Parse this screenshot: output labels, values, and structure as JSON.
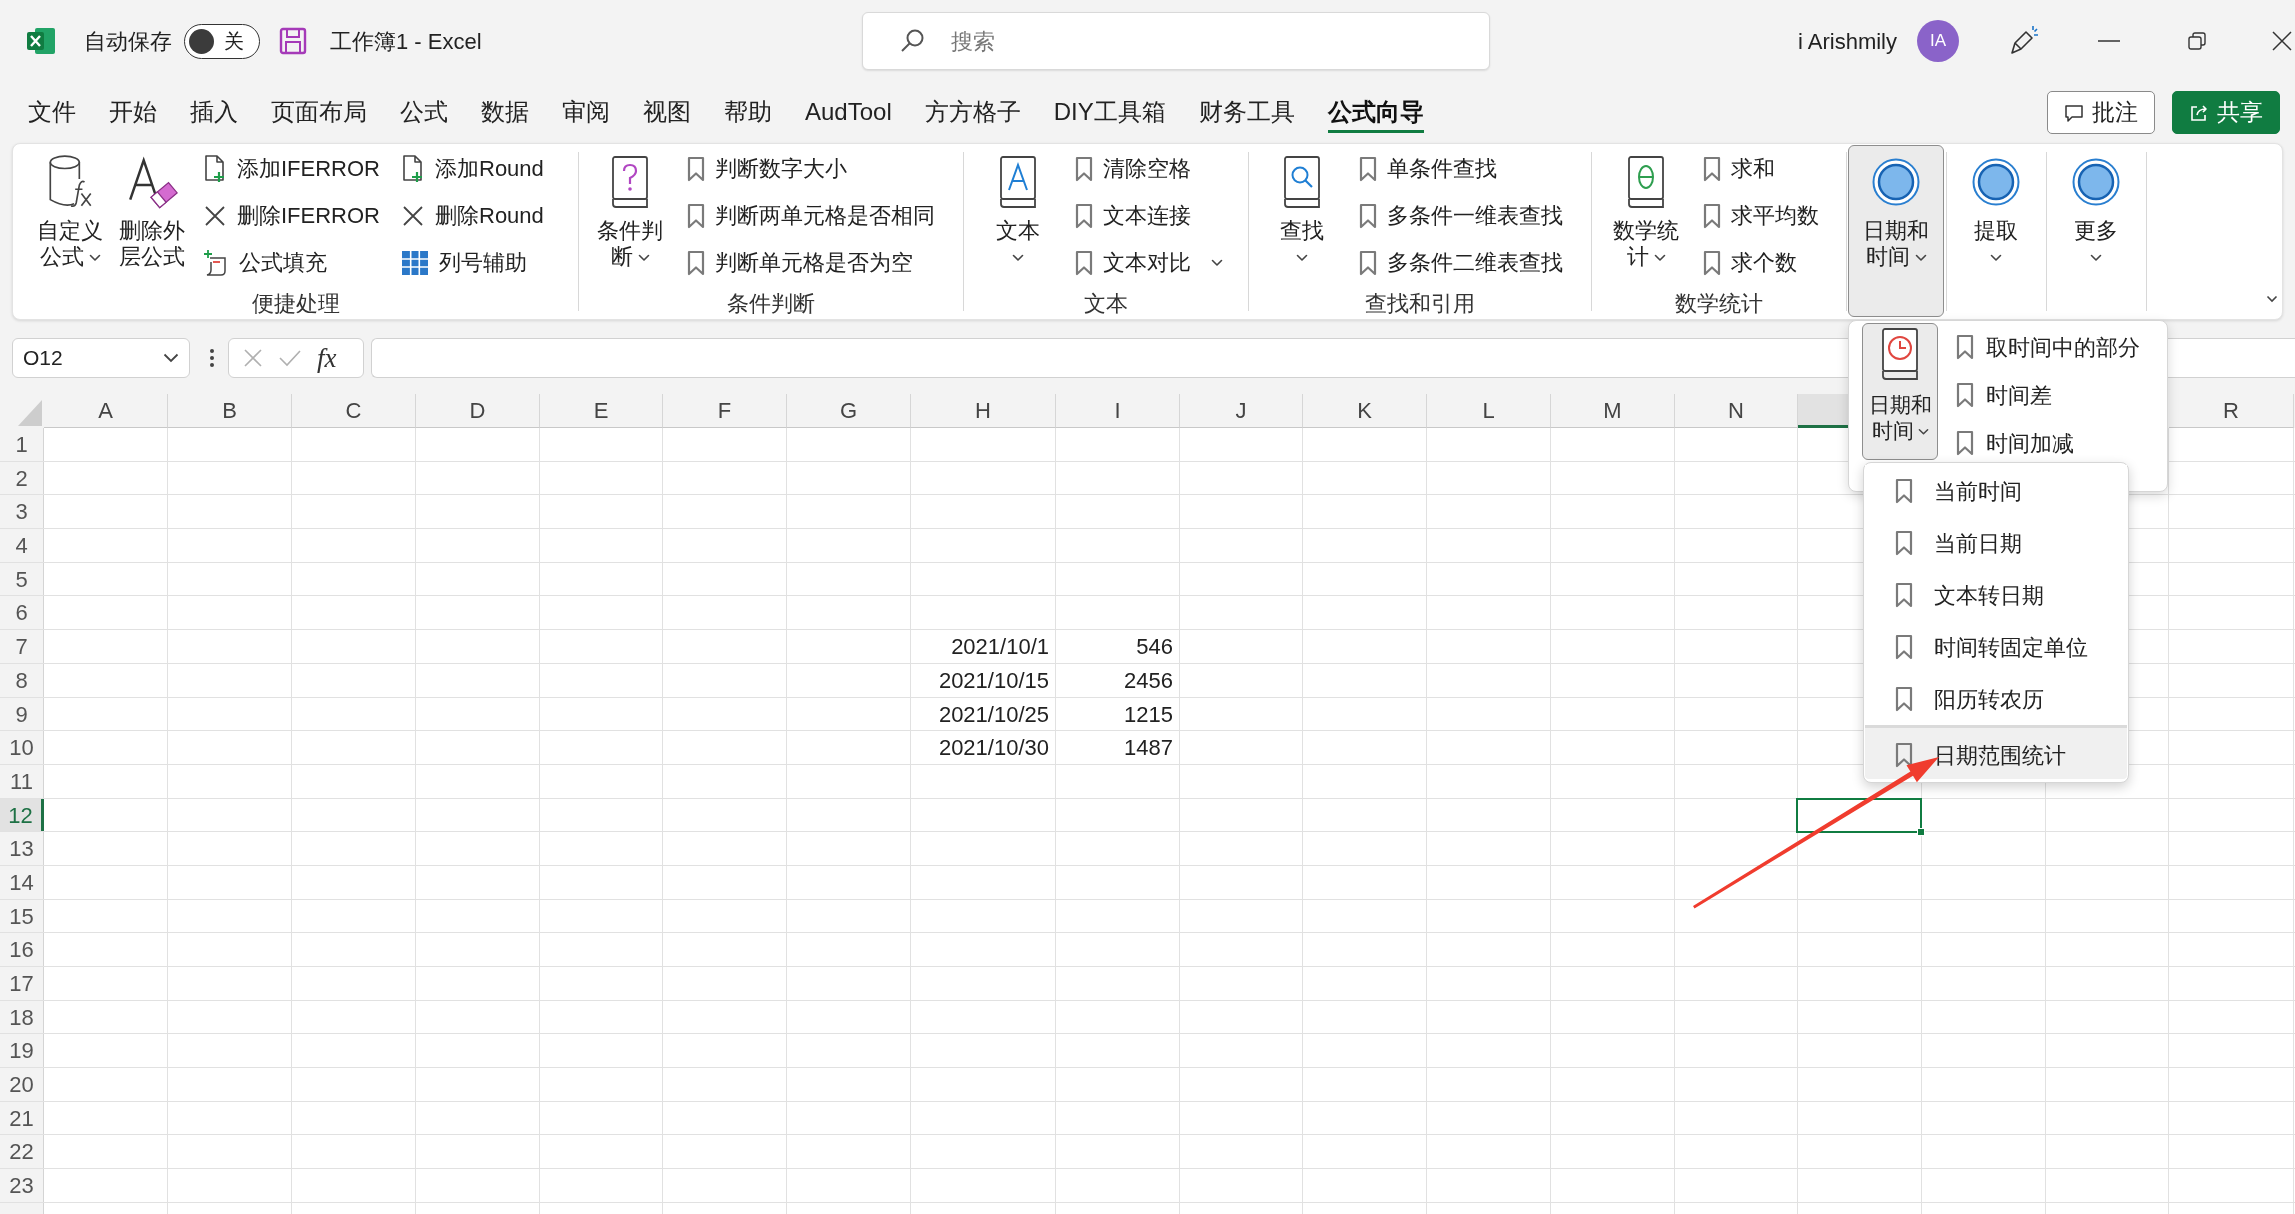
{
  "title_bar": {
    "autosave": {
      "label": "自动保存",
      "on": false,
      "state_label": "关"
    },
    "document_title": "工作簿1 - Excel",
    "search": {
      "placeholder": "搜索"
    },
    "user": {
      "name": "i Arishmily",
      "initials": "IA"
    }
  },
  "ribbon_tabs": [
    {
      "label": "文件",
      "selected": false
    },
    {
      "label": "开始",
      "selected": false
    },
    {
      "label": "插入",
      "selected": false
    },
    {
      "label": "页面布局",
      "selected": false
    },
    {
      "label": "公式",
      "selected": false
    },
    {
      "label": "数据",
      "selected": false
    },
    {
      "label": "审阅",
      "selected": false
    },
    {
      "label": "视图",
      "selected": false
    },
    {
      "label": "帮助",
      "selected": false
    },
    {
      "label": "AudTool",
      "selected": false
    },
    {
      "label": "方方格子",
      "selected": false
    },
    {
      "label": "DIY工具箱",
      "selected": false
    },
    {
      "label": "财务工具",
      "selected": false
    },
    {
      "label": "公式向导",
      "selected": true
    }
  ],
  "tab_row_buttons": [
    {
      "label": "批注",
      "kind": "outline"
    },
    {
      "label": "共享",
      "kind": "primary"
    }
  ],
  "ribbon": {
    "groups": [
      {
        "label": "便捷处理",
        "large_buttons": [
          {
            "label": "自定义公式",
            "dropdown": true,
            "expanded": false
          },
          {
            "label": "删除外层公式",
            "dropdown": false,
            "expanded": false
          }
        ],
        "small_columns": [
          [
            {
              "label": "添加IFERROR",
              "dropdown": false
            },
            {
              "label": "删除IFERROR",
              "dropdown": false
            },
            {
              "label": "公式填充",
              "dropdown": false
            }
          ],
          [
            {
              "label": "添加Round",
              "dropdown": false
            },
            {
              "label": "删除Round",
              "dropdown": false
            },
            {
              "label": "列号辅助",
              "dropdown": false
            }
          ]
        ]
      },
      {
        "label": "条件判断",
        "large_buttons": [
          {
            "label": "条件判断",
            "dropdown": true,
            "expanded": false
          }
        ],
        "small_columns": [
          [
            {
              "label": "判断数字大小",
              "dropdown": false
            },
            {
              "label": "判断两单元格是否相同",
              "dropdown": false
            },
            {
              "label": "判断单元格是否为空",
              "dropdown": false
            }
          ]
        ]
      },
      {
        "label": "文本",
        "large_buttons": [
          {
            "label": "文本",
            "dropdown": true,
            "expanded": false
          }
        ],
        "small_columns": [
          [
            {
              "label": "清除空格",
              "dropdown": false
            },
            {
              "label": "文本连接",
              "dropdown": false
            },
            {
              "label": "文本对比",
              "dropdown": true
            }
          ]
        ]
      },
      {
        "label": "查找和引用",
        "large_buttons": [
          {
            "label": "查找",
            "dropdown": true,
            "expanded": false
          }
        ],
        "small_columns": [
          [
            {
              "label": "单条件查找",
              "dropdown": false
            },
            {
              "label": "多条件一维表查找",
              "dropdown": false
            },
            {
              "label": "多条件二维表查找",
              "dropdown": false
            }
          ]
        ]
      },
      {
        "label": "数学统计",
        "large_buttons": [
          {
            "label": "数学统计",
            "dropdown": true,
            "expanded": false
          }
        ],
        "small_columns": [
          [
            {
              "label": "求和",
              "dropdown": false
            },
            {
              "label": "求平均数",
              "dropdown": false
            },
            {
              "label": "求个数",
              "dropdown": false
            }
          ]
        ]
      },
      {
        "large_buttons": [
          {
            "label": "日期和时间",
            "dropdown": true,
            "expanded": true
          }
        ]
      },
      {
        "large_buttons": [
          {
            "label": "提取",
            "dropdown": true,
            "expanded": false
          }
        ]
      },
      {
        "large_buttons": [
          {
            "label": "更多",
            "dropdown": true,
            "expanded": false
          }
        ]
      }
    ]
  },
  "formula_bar": {
    "name_box": "O12",
    "function_button": "fx"
  },
  "sheet": {
    "columns": [
      {
        "label": "A",
        "selected": false
      },
      {
        "label": "B",
        "selected": false
      },
      {
        "label": "C",
        "selected": false
      },
      {
        "label": "D",
        "selected": false
      },
      {
        "label": "E",
        "selected": false
      },
      {
        "label": "F",
        "selected": false
      },
      {
        "label": "G",
        "selected": false
      },
      {
        "label": "H",
        "selected": false
      },
      {
        "label": "I",
        "selected": false
      },
      {
        "label": "J",
        "selected": false
      },
      {
        "label": "K",
        "selected": false
      },
      {
        "label": "L",
        "selected": false
      },
      {
        "label": "M",
        "selected": false
      },
      {
        "label": "N",
        "selected": false
      },
      {
        "selected": true
      },
      {},
      {},
      {
        "label": "R",
        "selected": false
      }
    ],
    "rows": [
      {
        "label": "1",
        "selected": false
      },
      {
        "label": "2",
        "selected": false
      },
      {
        "label": "3",
        "selected": false
      },
      {
        "label": "4",
        "selected": false
      },
      {
        "label": "5",
        "selected": false
      },
      {
        "label": "6",
        "selected": false
      },
      {
        "label": "7",
        "selected": false,
        "cells": [
          null,
          null,
          null,
          null,
          null,
          null,
          null,
          "2021/10/1",
          "546"
        ]
      },
      {
        "label": "8",
        "selected": false,
        "cells": [
          null,
          null,
          null,
          null,
          null,
          null,
          null,
          "2021/10/15",
          "2456"
        ]
      },
      {
        "label": "9",
        "selected": false,
        "cells": [
          null,
          null,
          null,
          null,
          null,
          null,
          null,
          "2021/10/25",
          "1215"
        ]
      },
      {
        "label": "10",
        "selected": false,
        "cells": [
          null,
          null,
          null,
          null,
          null,
          null,
          null,
          "2021/10/30",
          "1487"
        ]
      },
      {
        "label": "11",
        "selected": false
      },
      {
        "label": "12",
        "selected": true
      },
      {
        "label": "13",
        "selected": false
      },
      {
        "label": "14",
        "selected": false
      },
      {
        "label": "15",
        "selected": false
      },
      {
        "label": "16",
        "selected": false
      },
      {
        "label": "17",
        "selected": false
      },
      {
        "label": "18",
        "selected": false
      },
      {
        "label": "19",
        "selected": false
      },
      {
        "label": "20",
        "selected": false
      },
      {
        "label": "21",
        "selected": false
      },
      {
        "label": "22",
        "selected": false
      },
      {
        "label": "23",
        "selected": false
      }
    ]
  },
  "date_time_menu": {
    "header_button": {
      "label": "日期和时间",
      "dropdown": true,
      "expanded": true
    },
    "side_items": [
      {
        "label": "取时间中的部分"
      },
      {
        "label": "时间差"
      },
      {
        "label": "时间加减"
      }
    ],
    "items": [
      {
        "label": "当前时间",
        "selected": false,
        "divider_above": false
      },
      {
        "label": "当前日期",
        "selected": false,
        "divider_above": false
      },
      {
        "label": "文本转日期",
        "selected": false,
        "divider_above": false
      },
      {
        "label": "时间转固定单位",
        "selected": false,
        "divider_above": false
      },
      {
        "label": "阳历转农历",
        "selected": false,
        "divider_above": false
      },
      {
        "label": "日期范围统计",
        "selected": true,
        "divider_above": true
      }
    ]
  }
}
